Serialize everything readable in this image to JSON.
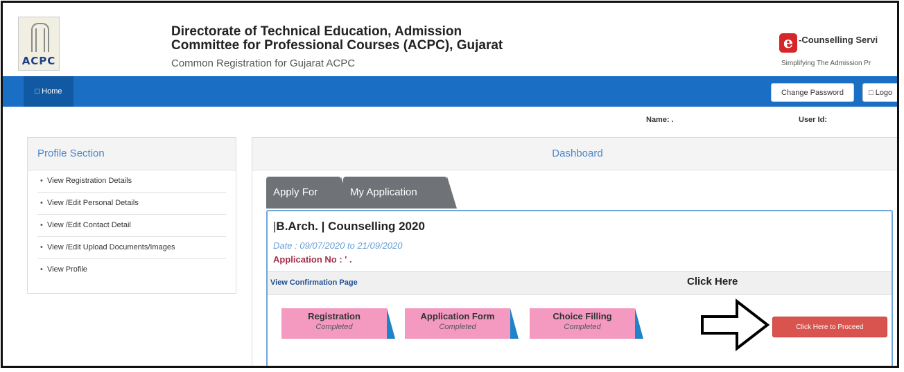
{
  "header": {
    "logo_text": "ACPC",
    "title_line1": "Directorate of Technical Education, Admission",
    "title_line2": "Committee for Professional Courses (ACPC), Gujarat",
    "subtitle": "Common Registration for Gujarat ACPC",
    "ec_logo_letter": "e",
    "ec_text": "-Counselling Servi",
    "ec_tagline": "Simplifying The Admission Pr"
  },
  "nav": {
    "home": "□ Home",
    "change_password": "Change Password",
    "logout": "□ Logo"
  },
  "user": {
    "name_label": "Name: .",
    "userid_label": "User Id:"
  },
  "profile": {
    "title": "Profile Section",
    "items": [
      "View Registration Details",
      "View /Edit Personal Details",
      "View /Edit Contact Detail",
      "View /Edit Upload Documents/Images",
      "View Profile"
    ]
  },
  "dashboard": {
    "title": "Dashboard",
    "tabs": [
      "Apply For",
      "My Application"
    ],
    "course_prefix": "|",
    "course_name": "B.Arch.",
    "course_suffix": " | Counselling 2020",
    "dates": "Date : 09/07/2020 to 21/09/2020",
    "application_no": "Application No : ' .",
    "confirmation_link": "View Confirmation Page",
    "click_here_note": "Click Here",
    "steps": [
      {
        "title": "Registration",
        "status": "Completed"
      },
      {
        "title": "Application Form",
        "status": "Completed"
      },
      {
        "title": "Choice Filling",
        "status": "Completed"
      }
    ],
    "proceed_button": "Click Here to Proceed"
  },
  "colors": {
    "navbar": "#1a6fc4",
    "step_fill": "#f49ac1",
    "step_accent": "#1e83c8",
    "proceed": "#d9534f",
    "tab": "#6f7377"
  }
}
